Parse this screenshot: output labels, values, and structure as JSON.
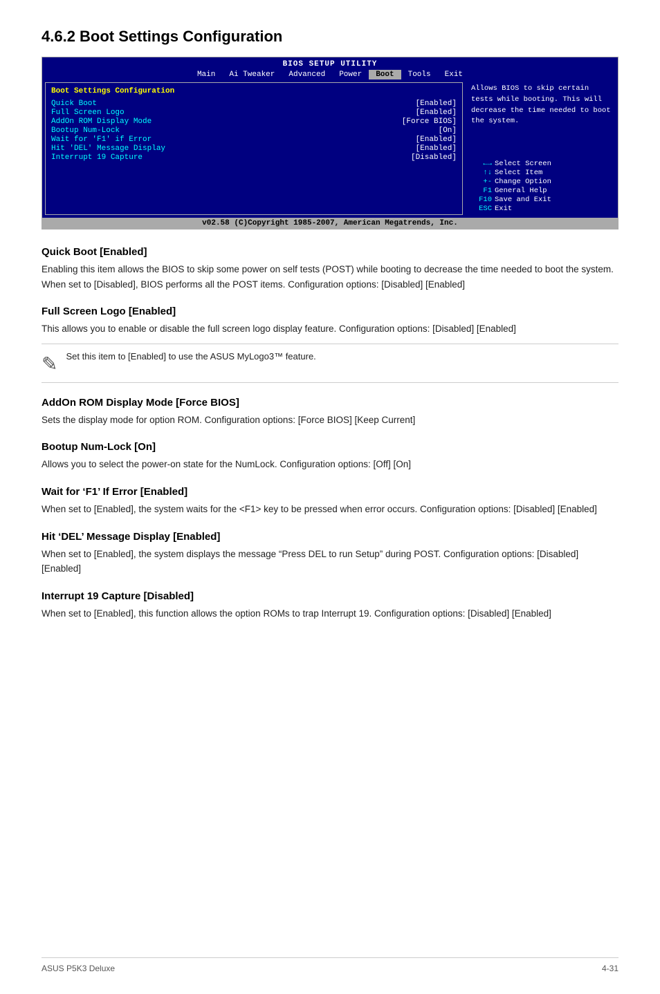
{
  "page": {
    "title": "4.6.2  Boot Settings Configuration",
    "footer_left": "ASUS P5K3 Deluxe",
    "footer_right": "4-31"
  },
  "bios": {
    "header_title": "BIOS SETUP UTILITY",
    "tabs": [
      "Main",
      "Ai Tweaker",
      "Advanced",
      "Power",
      "Boot",
      "Tools",
      "Exit"
    ],
    "active_tab": "Boot",
    "left_title": "Boot Settings Configuration",
    "items": [
      {
        "label": "Quick Boot",
        "value": "[Enabled]"
      },
      {
        "label": "Full Screen Logo",
        "value": "[Enabled]"
      },
      {
        "label": "AddOn ROM Display Mode",
        "value": "[Force BIOS]"
      },
      {
        "label": "Bootup Num-Lock",
        "value": "[On]"
      },
      {
        "label": "Wait for 'F1' if Error",
        "value": "[Enabled]"
      },
      {
        "label": "Hit 'DEL' Message Display",
        "value": "[Enabled]"
      },
      {
        "label": "Interrupt 19 Capture",
        "value": "[Disabled]"
      }
    ],
    "help_text": "Allows BIOS to skip certain tests while booting. This will decrease the time needed to boot the system.",
    "keys": [
      {
        "sym": "←→",
        "desc": "Select Screen"
      },
      {
        "sym": "↑↓",
        "desc": "Select Item"
      },
      {
        "sym": "+-",
        "desc": "Change Option"
      },
      {
        "sym": "F1",
        "desc": "General Help"
      },
      {
        "sym": "F10",
        "desc": "Save and Exit"
      },
      {
        "sym": "ESC",
        "desc": "Exit"
      }
    ],
    "footer": "v02.58 (C)Copyright 1985-2007, American Megatrends, Inc."
  },
  "sections": [
    {
      "id": "quick-boot",
      "heading": "Quick Boot [Enabled]",
      "body": "Enabling this item allows the BIOS to skip some power on self tests (POST) while booting to decrease the time needed to boot the system. When set to [Disabled], BIOS performs all the POST items. Configuration options: [Disabled] [Enabled]"
    },
    {
      "id": "full-screen-logo",
      "heading": "Full Screen Logo [Enabled]",
      "body": "This allows you to enable or disable the full screen logo display feature. Configuration options: [Disabled] [Enabled]"
    },
    {
      "id": "addon-rom",
      "heading": "AddOn ROM Display Mode [Force BIOS]",
      "body": "Sets the display mode for option ROM. Configuration options: [Force BIOS] [Keep Current]"
    },
    {
      "id": "bootup-numlock",
      "heading": "Bootup Num-Lock [On]",
      "body": "Allows you to select the power-on state for the NumLock. Configuration options: [Off] [On]"
    },
    {
      "id": "wait-f1",
      "heading": "Wait for ‘F1’ If Error [Enabled]",
      "body": "When set to [Enabled], the system waits for the <F1> key to be pressed when error occurs. Configuration options: [Disabled] [Enabled]"
    },
    {
      "id": "hit-del",
      "heading": "Hit ‘DEL’ Message Display [Enabled]",
      "body": "When set to [Enabled], the system displays the message “Press DEL to run Setup” during POST. Configuration options: [Disabled] [Enabled]"
    },
    {
      "id": "interrupt-19",
      "heading": "Interrupt 19 Capture [Disabled]",
      "body": "When set to [Enabled], this function allows the option ROMs to trap Interrupt 19. Configuration options: [Disabled] [Enabled]"
    }
  ],
  "note": {
    "icon": "✏",
    "text": "Set this item to [Enabled] to use the ASUS MyLogo3™ feature."
  }
}
